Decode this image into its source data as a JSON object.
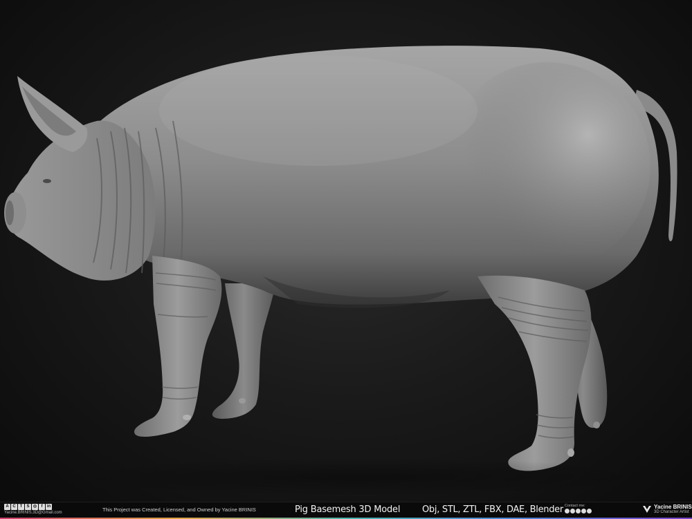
{
  "footer": {
    "credit": "This Project was Created, Licensed, and Owned by Yacine BRINIS",
    "title": "Pig Basemesh 3D Model",
    "formats": "Obj, STL, ZTL, FBX, DAE, Blender",
    "email": "Yacine.BRINIS.3D@Gmail.com",
    "contact_label": "Contact me:",
    "brand_name": "Yacine BRINIS",
    "brand_role": "3D Character Artist",
    "social_icons": [
      "artstation-icon",
      "cgtrader-icon",
      "turbosquid-icon",
      "sketchfab-icon",
      "instagram-icon",
      "facebook-icon",
      "linkedin-icon"
    ],
    "stripe_colors": [
      "#ff2a6d",
      "#ff9f1c",
      "#2ec4b6",
      "#3a86ff",
      "#8338ec"
    ]
  },
  "render": {
    "subject": "pig-sculpt",
    "background_color": "#1a1a1a",
    "material_color": "#8a8a8a"
  }
}
